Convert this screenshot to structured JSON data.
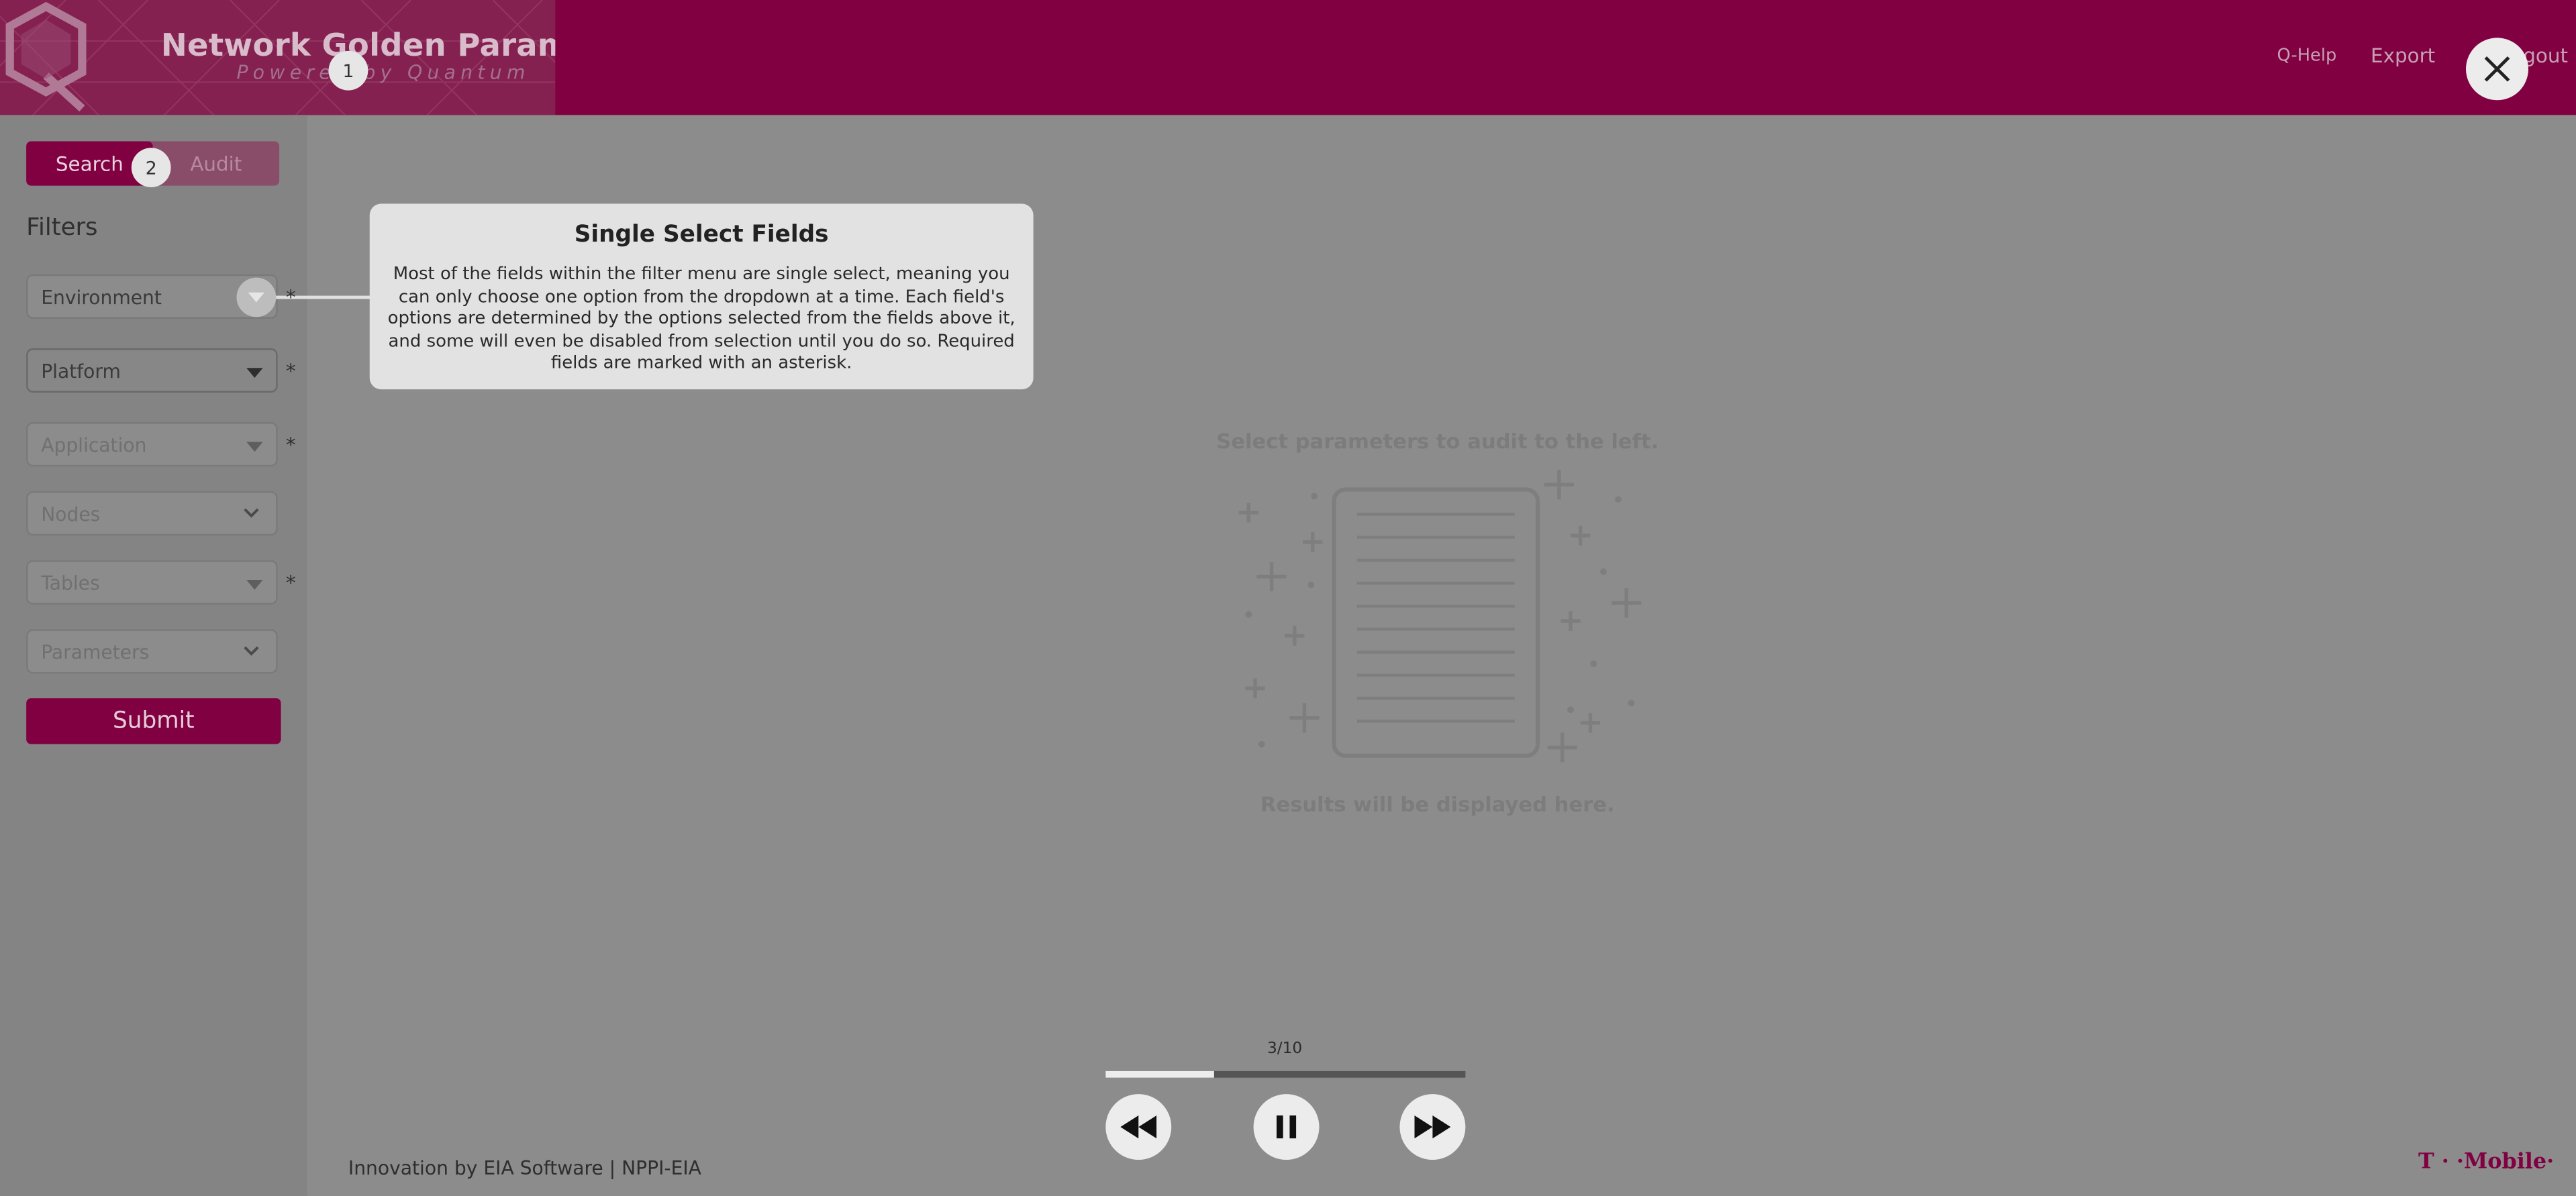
{
  "header": {
    "app_title": "Network Golden Parameter",
    "app_subtitle": "Powered by Quantum",
    "nav": {
      "help": "Q-Help",
      "export": "Export",
      "logout": "Logout"
    }
  },
  "brand_color": "#800041",
  "steps": {
    "one": "1",
    "two": "2"
  },
  "sidebar": {
    "tabs": {
      "search": "Search",
      "audit": "Audit"
    },
    "filters_title": "Filters",
    "fields": {
      "environment": "Environment",
      "platform": "Platform",
      "application": "Application",
      "nodes": "Nodes",
      "tables": "Tables",
      "parameters": "Parameters"
    },
    "required_mark": "*",
    "submit": "Submit"
  },
  "tooltip": {
    "title": "Single Select Fields",
    "body": "Most of the fields within the filter menu are single select, meaning you can only choose one option from the dropdown at a time. Each field's options are determined by the options selected from the fields above it, and some will even be disabled from selection until you do so. Required fields are marked with an asterisk."
  },
  "placeholder": {
    "top": "Select parameters to audit to the left.",
    "bottom": "Results will be displayed here.",
    "icon": "document-list-icon"
  },
  "player": {
    "counter": "3/10",
    "progress": 0.3
  },
  "footer": {
    "credit": "Innovation by EIA Software | NPPI-EIA",
    "brand": "T · ·Mobile·"
  }
}
